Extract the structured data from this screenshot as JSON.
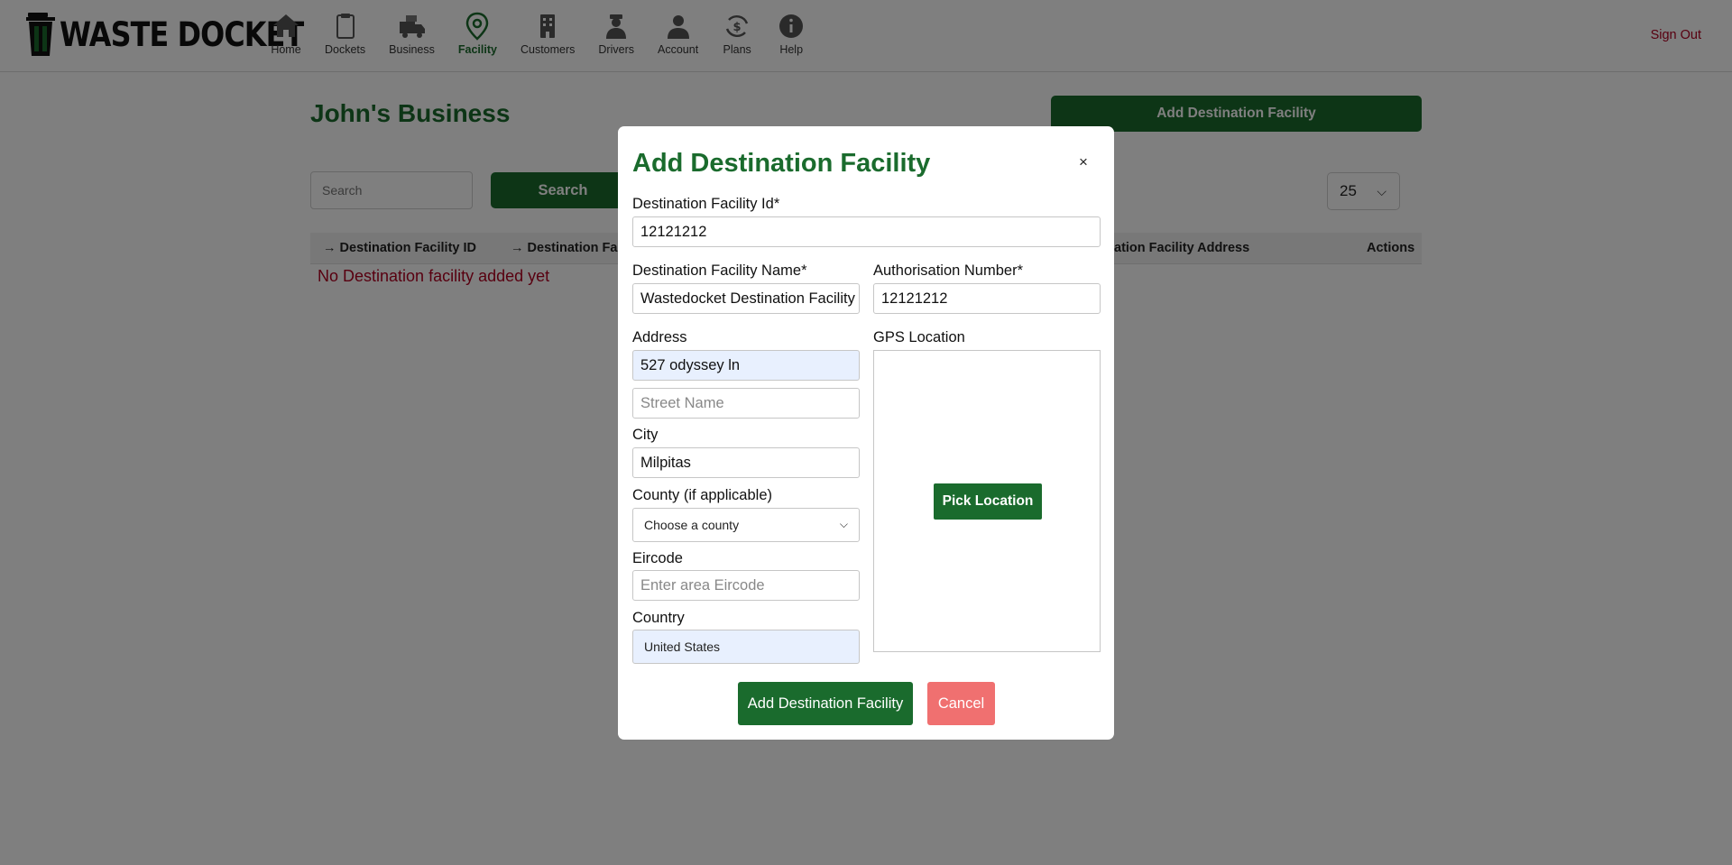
{
  "header": {
    "logo_text": "WASTE DOCKET",
    "nav": [
      {
        "label": "Home",
        "icon": "home-icon"
      },
      {
        "label": "Dockets",
        "icon": "clipboard-icon"
      },
      {
        "label": "Business",
        "icon": "truck-icon"
      },
      {
        "label": "Facility",
        "icon": "location-pin-icon",
        "active": true
      },
      {
        "label": "Customers",
        "icon": "building-icon"
      },
      {
        "label": "Drivers",
        "icon": "driver-icon"
      },
      {
        "label": "Account",
        "icon": "user-icon"
      },
      {
        "label": "Plans",
        "icon": "dollar-cycle-icon"
      },
      {
        "label": "Help",
        "icon": "info-icon"
      }
    ],
    "sign_out": "Sign Out"
  },
  "page": {
    "title": "John's Business",
    "add_button": "Add Destination Facility",
    "search_placeholder": "Search",
    "search_button": "Search",
    "per_page": "25",
    "columns": [
      "Destination Facility ID",
      "Destination Fac",
      "ation Facility Address",
      "Actions"
    ],
    "empty_message": "No Destination facility added yet"
  },
  "modal": {
    "title": "Add Destination Facility",
    "close": "×",
    "facility_id_label": "Destination Facility Id*",
    "facility_id_value": "12121212",
    "facility_name_label": "Destination Facility Name*",
    "facility_name_value": "Wastedocket Destination Facility",
    "auth_number_label": "Authorisation Number*",
    "auth_number_value": "12121212",
    "address_label": "Address",
    "address_value": "527 odyssey ln",
    "street_placeholder": "Street Name",
    "gps_label": "GPS Location",
    "pick_location": "Pick Location",
    "city_label": "City",
    "city_value": "Milpitas",
    "county_label": "County (if applicable)",
    "county_value": "Choose a county",
    "eircode_label": "Eircode",
    "eircode_placeholder": "Enter area Eircode",
    "country_label": "Country",
    "country_value": "United States",
    "submit_button": "Add Destination Facility",
    "cancel_button": "Cancel"
  },
  "colors": {
    "brand_green": "#1a6b2d",
    "signout_red": "#b00020",
    "cancel_red": "#f07070",
    "autofill_blue": "#e8f0fe"
  }
}
